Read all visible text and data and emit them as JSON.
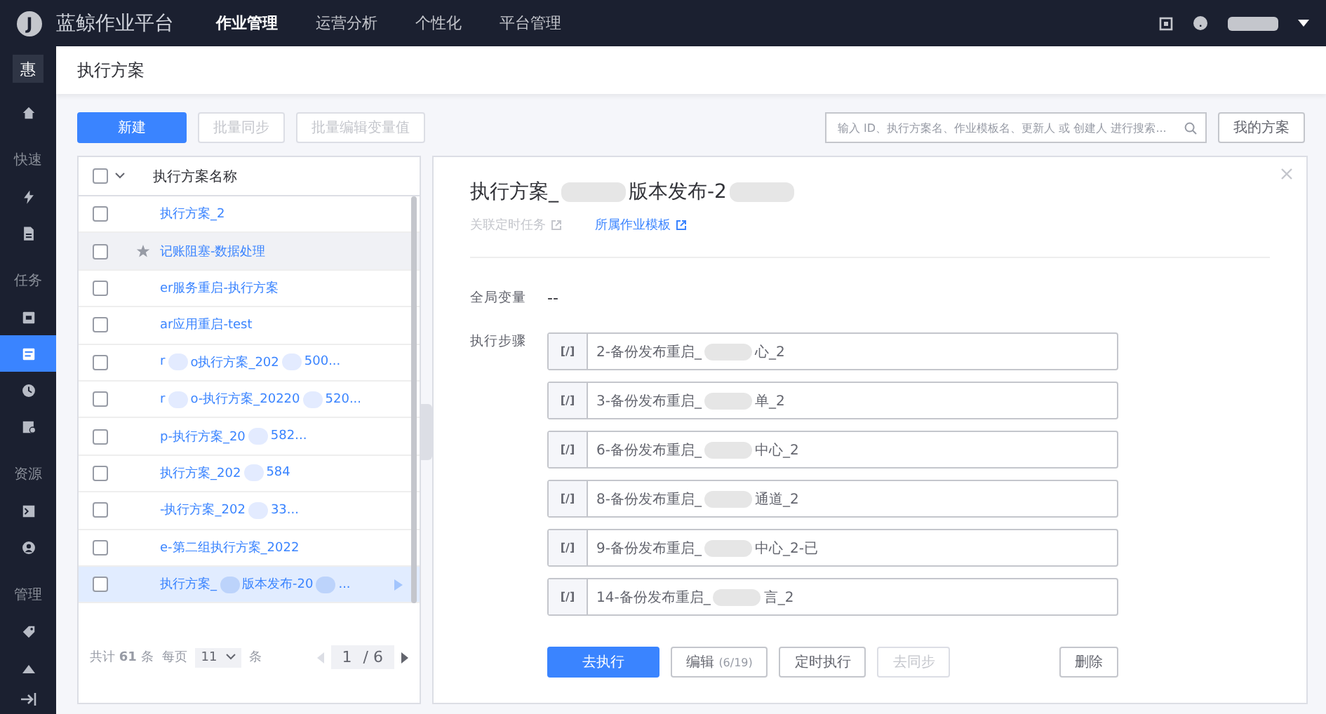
{
  "topbar": {
    "logo_mark": "J",
    "title": "蓝鲸作业平台",
    "nav": [
      {
        "label": "作业管理",
        "selected": true
      },
      {
        "label": "运营分析",
        "selected": false
      },
      {
        "label": "个性化",
        "selected": false
      },
      {
        "label": "平台管理",
        "selected": false
      }
    ]
  },
  "sidebar": {
    "badge": "惠",
    "sections": [
      {
        "items": [
          {
            "selected": false
          }
        ]
      },
      {
        "label": "快速",
        "items": [
          {
            "selected": false
          },
          {
            "selected": false
          }
        ]
      },
      {
        "label": "任务",
        "items": [
          {
            "selected": false
          },
          {
            "selected": true
          },
          {
            "selected": false
          },
          {
            "selected": false
          }
        ]
      },
      {
        "label": "资源",
        "items": [
          {
            "selected": false
          },
          {
            "selected": false
          }
        ]
      },
      {
        "label": "管理",
        "items": [
          {
            "selected": false
          }
        ]
      }
    ]
  },
  "page_title": "执行方案",
  "toolbar": {
    "buttons": [
      {
        "label": "新建",
        "kind": "primary"
      },
      {
        "label": "批量同步",
        "kind": "disabled"
      },
      {
        "label": "批量编辑变量值",
        "kind": "disabled"
      }
    ],
    "search": {
      "placeholder": "输入 ID、执行方案名、作业模板名、更新人 或 创建人 进行搜索..."
    },
    "my_button": "我的方案"
  },
  "list": {
    "column": "执行方案名称",
    "all_checked": false,
    "rows": [
      {
        "parts": [
          "执行方案_2"
        ],
        "checked": false,
        "starred": false,
        "selected": false,
        "hovered": false
      },
      {
        "parts": [
          "记账阻塞-数据处理"
        ],
        "checked": false,
        "starred": true,
        "selected": false,
        "hovered": true
      },
      {
        "parts": [
          "er服务重启-执行方案"
        ],
        "checked": false,
        "starred": false,
        "selected": false,
        "hovered": false
      },
      {
        "parts": [
          "ar应用重启-test"
        ],
        "checked": false,
        "starred": false,
        "selected": false,
        "hovered": false
      },
      {
        "parts": [
          "r",
          "o执行方案_202",
          "500..."
        ],
        "checked": false,
        "starred": false,
        "selected": false,
        "hovered": false
      },
      {
        "parts": [
          "r",
          "o-执行方案_20220",
          "520..."
        ],
        "checked": false,
        "starred": false,
        "selected": false,
        "hovered": false
      },
      {
        "parts": [
          "p-执行方案_20",
          "582..."
        ],
        "checked": false,
        "starred": false,
        "selected": false,
        "hovered": false
      },
      {
        "parts": [
          "执行方案_202",
          "584"
        ],
        "checked": false,
        "starred": false,
        "selected": false,
        "hovered": false
      },
      {
        "parts": [
          "-执行方案_202",
          "33..."
        ],
        "checked": false,
        "starred": false,
        "selected": false,
        "hovered": false
      },
      {
        "parts": [
          "e-第二组执行方案_2022"
        ],
        "checked": false,
        "starred": false,
        "selected": false,
        "hovered": false
      },
      {
        "parts": [
          "执行方案_",
          "版本发布-20",
          "..."
        ],
        "checked": false,
        "starred": false,
        "selected": true,
        "hovered": false
      }
    ],
    "footer": {
      "total_prefix": "共计",
      "total": "61",
      "total_suffix": "条",
      "per_page_prefix": "每页",
      "per_page": "11",
      "per_page_suffix": "条",
      "page": "1",
      "pages": "/ 6"
    }
  },
  "detail": {
    "title_parts": [
      "执行方案_",
      "版本发布-2"
    ],
    "links": [
      {
        "label": "关联定时任务",
        "disabled": true
      },
      {
        "label": "所属作业模板",
        "disabled": false
      }
    ],
    "global_vars_label": "全局变量",
    "global_vars_value": "--",
    "steps_label": "执行步骤",
    "steps": [
      {
        "tag": "[/]",
        "parts": [
          "2-备份发布重启_",
          "心_2"
        ]
      },
      {
        "tag": "[/]",
        "parts": [
          "3-备份发布重启_",
          "单_2"
        ]
      },
      {
        "tag": "[/]",
        "parts": [
          "6-备份发布重启_",
          "中心_2"
        ]
      },
      {
        "tag": "[/]",
        "parts": [
          "8-备份发布重启_",
          "通道_2"
        ]
      },
      {
        "tag": "[/]",
        "parts": [
          "9-备份发布重启_",
          "中心_2-已"
        ]
      },
      {
        "tag": "[/]",
        "parts": [
          "14-备份发布重启_",
          "言_2"
        ]
      }
    ],
    "actions": [
      {
        "label": "去执行",
        "kind": "primary"
      },
      {
        "label": "编辑",
        "count": "(6/19)",
        "kind": "default"
      },
      {
        "label": "定时执行",
        "kind": "default"
      },
      {
        "label": "去同步",
        "kind": "disabled"
      }
    ],
    "delete_button": "删除"
  }
}
